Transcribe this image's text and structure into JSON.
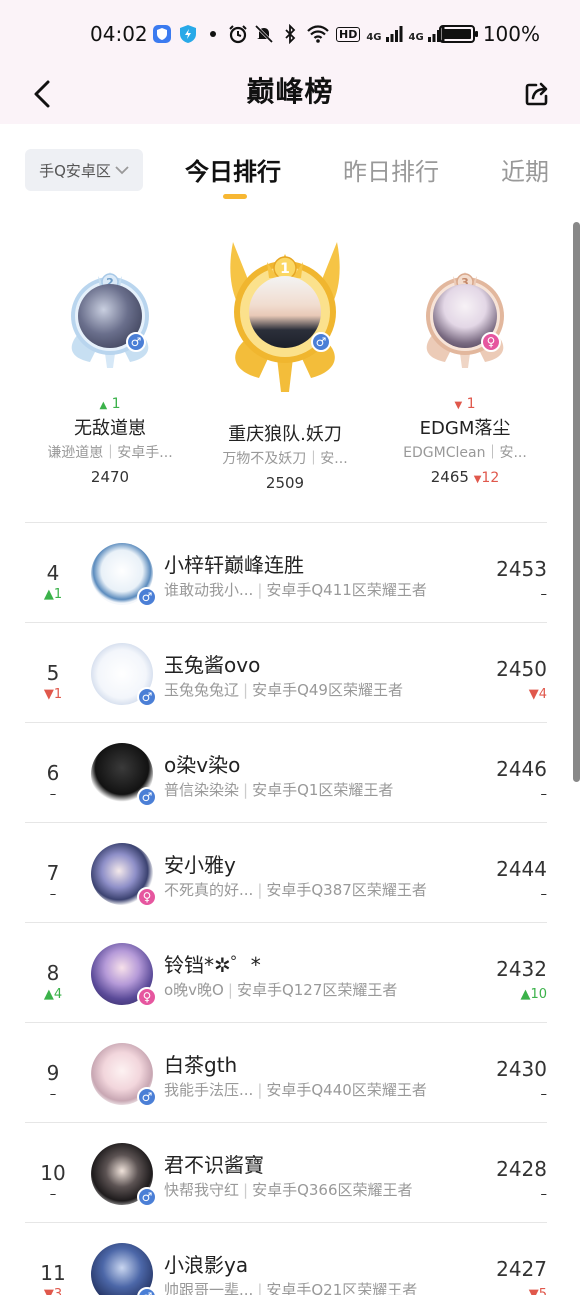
{
  "status_bar": {
    "time": "04:02",
    "signal1": "4G",
    "signal2": "4G",
    "hd": "HD",
    "battery": "100%"
  },
  "nav": {
    "title": "巅峰榜"
  },
  "tabs": {
    "region": "手Q安卓区",
    "items": [
      "今日排行",
      "昨日排行",
      "近期"
    ],
    "active_index": 0
  },
  "podium": [
    {
      "place": "1",
      "change_arrow": "",
      "change": "",
      "name": "重庆狼队.妖刀",
      "sub": "万物不及妖刀｜安...",
      "score": "2509",
      "gender_symbol": "♂"
    },
    {
      "place": "2",
      "change_arrow": "▲",
      "change": "1",
      "name": "无敌道崽",
      "sub": "谦逊道崽｜安卓手...",
      "score": "2470",
      "gender_symbol": "♂"
    },
    {
      "place": "3",
      "change_arrow": "▼",
      "change": "1",
      "name": "EDGM落尘",
      "sub": "EDGMClean｜安...",
      "score": "2465",
      "score_change_arrow": "▼",
      "score_change": "12",
      "gender_symbol": "♀"
    }
  ],
  "list": [
    {
      "rank": "4",
      "rank_change": "▲1",
      "name": "小梓轩巅峰连胜",
      "nick": "谁敢动我小...",
      "server": "安卓手Q411区荣耀王者",
      "score": "2453",
      "score_change": "–",
      "gender_symbol": "♂"
    },
    {
      "rank": "5",
      "rank_change": "▼1",
      "name": "玉兔酱ovo",
      "nick": "玉兔兔兔辽",
      "server": "安卓手Q49区荣耀王者",
      "score": "2450",
      "score_change": "▼4",
      "gender_symbol": "♂"
    },
    {
      "rank": "6",
      "rank_change": "–",
      "name": "o染v染o",
      "nick": "普信染染染",
      "server": "安卓手Q1区荣耀王者",
      "score": "2446",
      "score_change": "–",
      "gender_symbol": "♂"
    },
    {
      "rank": "7",
      "rank_change": "–",
      "name": "安小雅y",
      "nick": "不死真的好...",
      "server": "安卓手Q387区荣耀王者",
      "score": "2444",
      "score_change": "–",
      "gender_symbol": "♀"
    },
    {
      "rank": "8",
      "rank_change": "▲4",
      "name": "铃铛*✲゜*",
      "nick": "o晚v晚O",
      "server": "安卓手Q127区荣耀王者",
      "score": "2432",
      "score_change": "▲10",
      "gender_symbol": "♀"
    },
    {
      "rank": "9",
      "rank_change": "–",
      "name": "白茶gth",
      "nick": "我能手法压...",
      "server": "安卓手Q440区荣耀王者",
      "score": "2430",
      "score_change": "–",
      "gender_symbol": "♂"
    },
    {
      "rank": "10",
      "rank_change": "–",
      "name": "君不识酱寶",
      "nick": "快帮我守红",
      "server": "安卓手Q366区荣耀王者",
      "score": "2428",
      "score_change": "–",
      "gender_symbol": "♂"
    },
    {
      "rank": "11",
      "rank_change": "▼3",
      "name": "小浪影ya",
      "nick": "帅跟哥一辈...",
      "server": "安卓手Q21区荣耀王者",
      "score": "2427",
      "score_change": "▼5",
      "gender_symbol": "♂"
    }
  ],
  "colors": {
    "header_bg": "#fbf3f8",
    "tab_indicator": "#f7b733",
    "rise": "#3bb24a",
    "fall": "#e0584c",
    "male": "#4b7fd6",
    "female": "#e6569f"
  }
}
